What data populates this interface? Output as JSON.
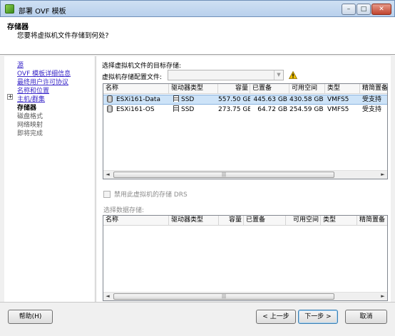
{
  "window": {
    "title": "部署 OVF 模板",
    "controls": {
      "minimize": "–",
      "maximize": "□",
      "close": "✕"
    }
  },
  "header": {
    "title": "存储器",
    "subtitle": "您要将虚拟机文件存储到何处?"
  },
  "nav": {
    "items": [
      {
        "label": "源",
        "state": "link"
      },
      {
        "label": "OVF 模板详细信息",
        "state": "link"
      },
      {
        "label": "最终用户许可协议",
        "state": "link"
      },
      {
        "label": "名称和位置",
        "state": "link"
      },
      {
        "label": "主机/群集",
        "state": "link"
      },
      {
        "label": "存储器",
        "state": "current"
      },
      {
        "label": "磁盘格式",
        "state": "disabled"
      },
      {
        "label": "网络映射",
        "state": "disabled"
      },
      {
        "label": "即将完成",
        "state": "disabled"
      }
    ],
    "expand_glyph": "+"
  },
  "main": {
    "select_label": "选择虚拟机文件的目标存储:",
    "profile_label": "虚拟机存储配置文件:",
    "profile_value": "",
    "profile_arrow": "▼",
    "datastore_table": {
      "columns": [
        "名称",
        "驱动器类型",
        "容量",
        "已置备",
        "可用空间",
        "类型",
        "精简置备"
      ],
      "rows": [
        {
          "name": "ESXi161-Data",
          "drive": "SSD",
          "capacity": "557.50 GB",
          "provisioned": "445.63 GB",
          "free": "430.58 GB",
          "type": "VMFS5",
          "thin": "受支持",
          "selected": true
        },
        {
          "name": "ESXi161-OS",
          "drive": "SSD",
          "capacity": "273.75 GB",
          "provisioned": "64.72 GB",
          "free": "254.59 GB",
          "type": "VMFS5",
          "thin": "受支持",
          "selected": false
        }
      ]
    },
    "drs_checkbox_label": "禁用此虚拟机的存储 DRS",
    "drs_checked": false,
    "select_datastore_label": "选择数据存储:",
    "datastore_table2": {
      "columns": [
        "名称",
        "驱动器类型",
        "容量",
        "已置备",
        "可用空间",
        "类型",
        "精简置备"
      ],
      "rows": []
    },
    "scroll_left": "◄",
    "scroll_right": "►",
    "scroll_grip": "|||"
  },
  "footer": {
    "help": "帮助(H)",
    "back": "< 上一步",
    "next": "下一步 >",
    "cancel": "取消"
  },
  "colors": {
    "link": "#3a28c9",
    "selection": "#cde3f8",
    "warning": "#f2c200"
  },
  "icons": [
    "app-icon",
    "warning-icon",
    "datastore-icon",
    "ssd-icon"
  ]
}
